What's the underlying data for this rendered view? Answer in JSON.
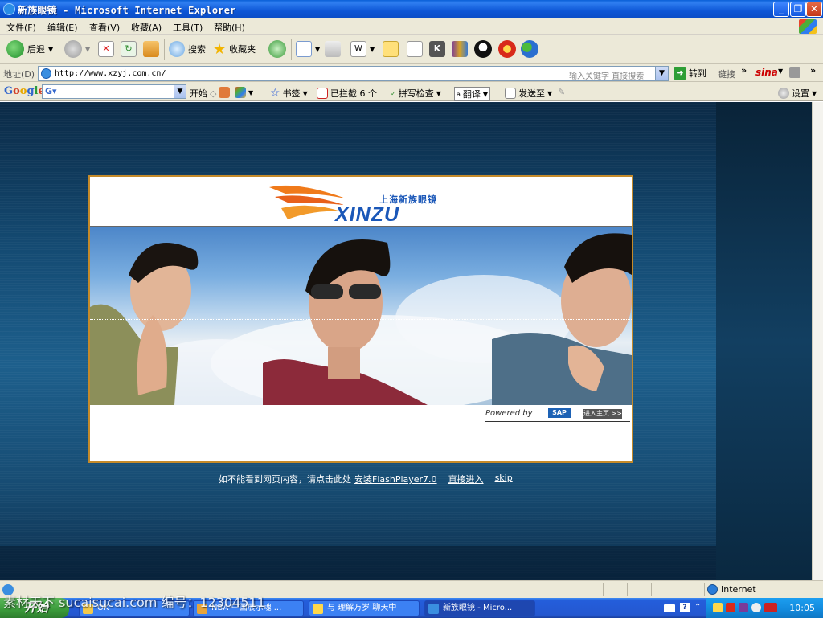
{
  "window": {
    "title": "新族眼镜 - Microsoft Internet Explorer"
  },
  "menu": [
    "文件(F)",
    "编辑(E)",
    "查看(V)",
    "收藏(A)",
    "工具(T)",
    "帮助(H)"
  ],
  "toolbar": {
    "back": "后退",
    "search": "搜索",
    "favorites": "收藏夹"
  },
  "address": {
    "label": "地址(D)",
    "url": "http://www.xzyj.com.cn/",
    "search_hint": "输入关键字 直接搜索",
    "go": "转到",
    "links": "链接",
    "sina": "sina"
  },
  "google_bar": {
    "logo": "Google",
    "start": "开始",
    "bookmarks": "书签",
    "blocked": "已拦截 6 个",
    "spellcheck": "拼写检查",
    "translate": "翻译",
    "send_to": "发送至",
    "settings": "设置"
  },
  "page": {
    "logo_cn": "上海新族眼镜",
    "logo_en": "XINZU",
    "powered_by": "Powered by",
    "sap": "SAP",
    "enter_home": "进入主页 >>",
    "notice": "如不能看到网页内容，请点击此处",
    "install_flash": "安装FlashPlayer7.0",
    "enter_direct": "直接进入",
    "skip": "skip"
  },
  "status": {
    "zone": "Internet"
  },
  "taskbar": {
    "start": "开始",
    "tasks": [
      "OK",
      "NBA-中国展示魂 ...",
      "与 理解万岁 聊天中",
      "新族眼镜 - Micro..."
    ],
    "clock": "10:05"
  },
  "watermark": "素材天下 sucaisucai.com  编号：12304511"
}
